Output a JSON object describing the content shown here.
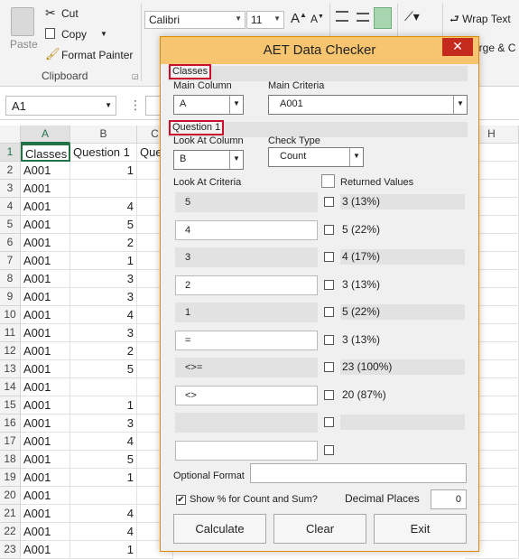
{
  "ribbon": {
    "paste": "Paste",
    "cut": "Cut",
    "copy": "Copy",
    "format_painter": "Format Painter",
    "clipboard": "Clipboard",
    "font_name": "Calibri",
    "font_size": "11",
    "wrap_text": "Wrap Text",
    "merge_center": "erge & C"
  },
  "formula_bar": {
    "name_box": "A1",
    "fx": "⋮"
  },
  "columns": [
    "A",
    "B",
    "C",
    "H"
  ],
  "rows": [
    {
      "n": "1",
      "a": "Classes",
      "b": "Question 1",
      "c": "Que"
    },
    {
      "n": "2",
      "a": "A001",
      "b": "1",
      "c": ""
    },
    {
      "n": "3",
      "a": "A001",
      "b": "",
      "c": ""
    },
    {
      "n": "4",
      "a": "A001",
      "b": "4",
      "c": ""
    },
    {
      "n": "5",
      "a": "A001",
      "b": "5",
      "c": ""
    },
    {
      "n": "6",
      "a": "A001",
      "b": "2",
      "c": ""
    },
    {
      "n": "7",
      "a": "A001",
      "b": "1",
      "c": ""
    },
    {
      "n": "8",
      "a": "A001",
      "b": "3",
      "c": ""
    },
    {
      "n": "9",
      "a": "A001",
      "b": "3",
      "c": ""
    },
    {
      "n": "10",
      "a": "A001",
      "b": "4",
      "c": ""
    },
    {
      "n": "11",
      "a": "A001",
      "b": "3",
      "c": ""
    },
    {
      "n": "12",
      "a": "A001",
      "b": "2",
      "c": ""
    },
    {
      "n": "13",
      "a": "A001",
      "b": "5",
      "c": ""
    },
    {
      "n": "14",
      "a": "A001",
      "b": "",
      "c": ""
    },
    {
      "n": "15",
      "a": "A001",
      "b": "1",
      "c": ""
    },
    {
      "n": "16",
      "a": "A001",
      "b": "3",
      "c": ""
    },
    {
      "n": "17",
      "a": "A001",
      "b": "4",
      "c": ""
    },
    {
      "n": "18",
      "a": "A001",
      "b": "5",
      "c": ""
    },
    {
      "n": "19",
      "a": "A001",
      "b": "1",
      "c": ""
    },
    {
      "n": "20",
      "a": "A001",
      "b": "",
      "c": ""
    },
    {
      "n": "21",
      "a": "A001",
      "b": "4",
      "c": ""
    },
    {
      "n": "22",
      "a": "A001",
      "b": "4",
      "c": ""
    },
    {
      "n": "23",
      "a": "A001",
      "b": "1",
      "c": ""
    }
  ],
  "dialog": {
    "title": "AET Data Checker",
    "close": "✕",
    "classes_frame": "Classes",
    "main_column_label": "Main Column",
    "main_column_value": "A",
    "main_criteria_label": "Main Criteria",
    "main_criteria_value": "A001",
    "question_frame": "Question 1",
    "look_at_column_label": "Look At Column",
    "look_at_column_value": "B",
    "check_type_label": "Check Type",
    "check_type_value": "Count",
    "look_at_criteria_label": "Look At Criteria",
    "returned_values_label": "Returned Values",
    "criteria": [
      {
        "value": "5",
        "result": "3  (13%)"
      },
      {
        "value": "4",
        "result": "5  (22%)"
      },
      {
        "value": "3",
        "result": "4  (17%)"
      },
      {
        "value": "2",
        "result": "3  (13%)"
      },
      {
        "value": "1",
        "result": "5  (22%)"
      },
      {
        "value": "=",
        "result": "3  (13%)"
      },
      {
        "value": "<>=",
        "result": "23  (100%)"
      },
      {
        "value": "<>",
        "result": "20  (87%)"
      },
      {
        "value": "",
        "result": ""
      },
      {
        "value": "",
        "result": ""
      }
    ],
    "optional_format_label": "Optional Format",
    "optional_format_value": "",
    "show_percent_label": "Show % for Count and Sum?",
    "show_percent_checked": "✔",
    "decimal_places_label": "Decimal Places",
    "decimal_places_value": "0",
    "calculate": "Calculate",
    "clear": "Clear",
    "exit": "Exit"
  }
}
